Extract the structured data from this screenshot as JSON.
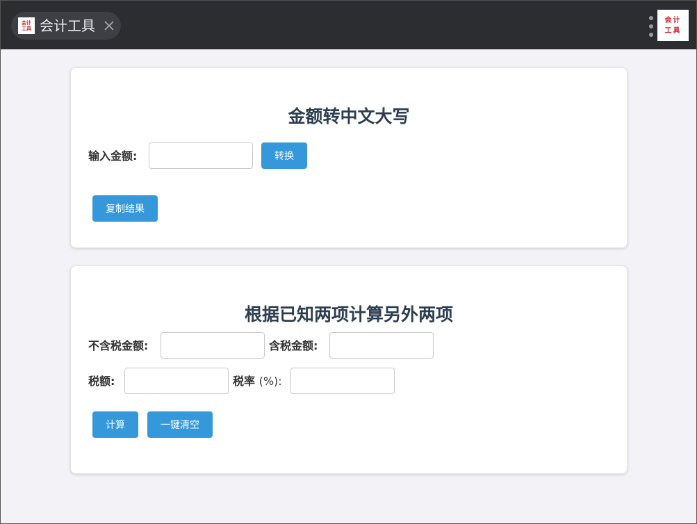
{
  "tab": {
    "title": "会计工具",
    "icon_line1": "会计",
    "icon_line2": "工具"
  },
  "app_logo": {
    "line1": "会计",
    "line2": "工具"
  },
  "amount_to_chinese": {
    "title": "金额转中文大写",
    "input_label": "输入金额:",
    "input_value": "",
    "convert_button": "转换",
    "copy_button": "复制结果"
  },
  "tax_calculator": {
    "title": "根据已知两项计算另外两项",
    "amount_excl_tax_label": "不含税金额:",
    "amount_incl_tax_label": "含税金额:",
    "tax_amount_label": "税额:",
    "tax_rate_label_main": "税率",
    "tax_rate_label_unit": "(%):",
    "calculate_button": "计算",
    "clear_button": "一键清空"
  },
  "colors": {
    "accent": "#3498db",
    "title_text": "#2c3e50",
    "logo_red": "#d0232a"
  }
}
